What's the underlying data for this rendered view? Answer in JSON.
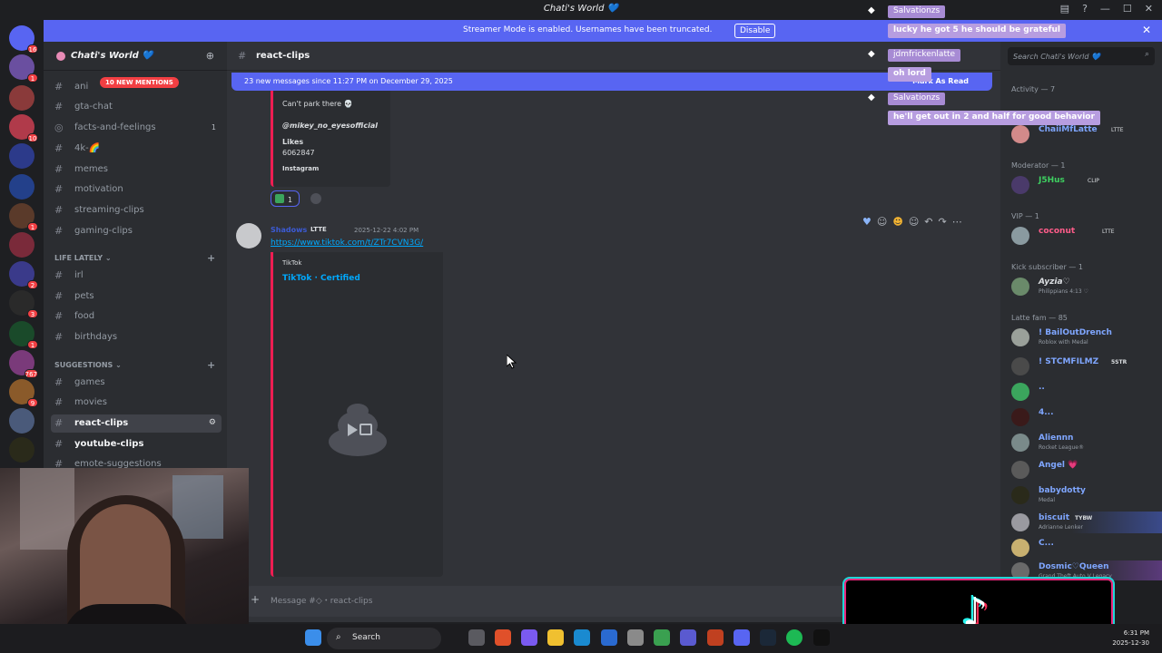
{
  "window": {
    "title": "Chati's World 💙"
  },
  "banner": {
    "text": "Streamer Mode is enabled. Usernames have been truncated.",
    "disable_label": "Disable"
  },
  "server": {
    "name": "Chati's World 💙"
  },
  "sidebar": {
    "mentions_pill": "10 NEW MENTIONS",
    "channels_top": [
      {
        "name": "ani",
        "count": ""
      },
      {
        "name": "gta-chat",
        "count": ""
      },
      {
        "name": "facts-and-feelings",
        "count": "1"
      },
      {
        "name": "4k-🌈",
        "count": ""
      },
      {
        "name": "memes",
        "count": ""
      },
      {
        "name": "motivation",
        "count": ""
      },
      {
        "name": "streaming-clips",
        "count": ""
      },
      {
        "name": "gaming-clips",
        "count": ""
      }
    ],
    "category_life": "LIFE LATELY",
    "channels_life": [
      "irl",
      "pets",
      "food",
      "birthdays"
    ],
    "category_suggestions": "SUGGESTIONS",
    "channels_sugg": [
      "games",
      "movies",
      "react-clips",
      "youtube-clips",
      "emote-suggestions"
    ]
  },
  "chat": {
    "channel_name": "react-clips",
    "new_messages": "23 new messages since 11:27 PM on December 29, 2025",
    "mark_as_read": "Mark As Read",
    "embed1": {
      "caption": "Can't park there 💀",
      "author": "@mikey_no_eyesofficial",
      "likes_label": "Likes",
      "likes_value": "6062847",
      "source": "Instagram"
    },
    "reaction_count": "1",
    "message": {
      "author": "Shadows",
      "badge": "LTTE",
      "timestamp": "2025-12-22 4:02 PM",
      "link": "https://www.tiktok.com/t/ZTr7CVN3G/",
      "embed_provider": "TikTok",
      "embed_title": "TikTok · Certified"
    },
    "composer_placeholder": "Message #◇・react-clips"
  },
  "members": {
    "search_placeholder": "Search Chati's World 💙",
    "activity": "Activity — 7",
    "sections": {
      "mod": "Moderator — 1",
      "vip": "VIP — 1",
      "kick": "Kick subscriber — 1",
      "fam": "Latte fam — 85"
    },
    "top": {
      "name": "ChaiiMfLatte",
      "tag": "LTTE"
    },
    "moderator": {
      "name": "J5Hus",
      "tag": "CLIP"
    },
    "vip": {
      "name": "coconut",
      "tag": "LTTE"
    },
    "kick": {
      "name": "Ayzia♡",
      "sub": "Philippians 4:13 ♡"
    },
    "fam": [
      {
        "name": "! BailOutDrench",
        "sub": "Roblox with Medal",
        "tag": ""
      },
      {
        "name": "! STCMFILMZ",
        "sub": "",
        "tag": "5STR"
      },
      {
        "name": "..",
        "sub": "",
        "tag": ""
      },
      {
        "name": "4...",
        "sub": "",
        "tag": ""
      },
      {
        "name": "Aliennn",
        "sub": "Rocket League®",
        "tag": ""
      },
      {
        "name": "Angel 💗",
        "sub": "",
        "tag": ""
      },
      {
        "name": "babydotty",
        "sub": "Medal",
        "tag": ""
      },
      {
        "name": "biscuit",
        "sub": "Adrianne Lenker",
        "tag": "TYBW"
      },
      {
        "name": "C...",
        "sub": "",
        "tag": ""
      },
      {
        "name": "Dosmic♡Queen",
        "sub": "Grand Theft Auto V Legacy",
        "tag": ""
      }
    ]
  },
  "overlay": {
    "user1": "Salvationzs",
    "msg1": "lucky he got 5 he should be grateful",
    "user2": "jdmfrickenlatte",
    "msg2": "oh lord",
    "user3": "Salvationzs",
    "msg3": "he'll get out in 2 and half for good behavior"
  },
  "taskbar": {
    "search": "Search",
    "time": "6:31 PM",
    "date": "2025-12-30"
  },
  "rail_badges": [
    "16",
    "1",
    "10",
    "1",
    "2",
    "3",
    "1",
    "767",
    "9"
  ]
}
